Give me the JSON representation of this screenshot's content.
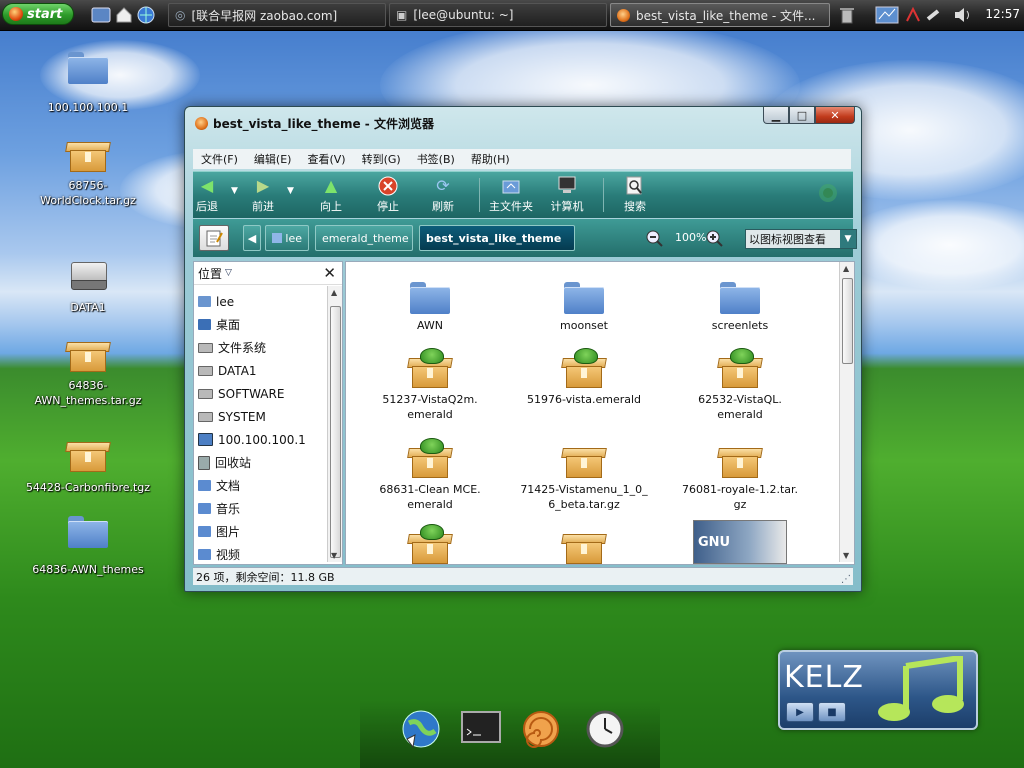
{
  "top_panel": {
    "start_label": "start",
    "tasks": [
      {
        "label": "[联合早报网 zaobao.com]"
      },
      {
        "label": "[lee@ubuntu: ~]"
      },
      {
        "label": "best_vista_like_theme - 文件..."
      }
    ],
    "clock": "12:57"
  },
  "desktop": {
    "icons": [
      {
        "label": "100.100.100.1"
      },
      {
        "label": "68756-WorldClock.tar.gz"
      },
      {
        "label": "DATA1"
      },
      {
        "label": "64836-AWN_themes.tar.gz"
      },
      {
        "label": "54428-Carbonfibre.tgz"
      },
      {
        "label": "64836-AWN_themes"
      }
    ]
  },
  "window": {
    "title": "best_vista_like_theme - 文件浏览器",
    "menu": [
      "文件(F)",
      "编辑(E)",
      "查看(V)",
      "转到(G)",
      "书签(B)",
      "帮助(H)"
    ],
    "toolbar": {
      "back": "后退",
      "forward": "前进",
      "up": "向上",
      "stop": "停止",
      "reload": "刷新",
      "home": "主文件夹",
      "computer": "计算机",
      "search": "搜索"
    },
    "breadcrumbs": [
      "lee",
      "emerald_theme",
      "best_vista_like_theme"
    ],
    "zoom": "100%",
    "view_mode": "以图标视图查看",
    "sidebar": {
      "title": "位置",
      "items": [
        {
          "label": "lee",
          "icon": "home"
        },
        {
          "label": "桌面",
          "icon": "desk"
        },
        {
          "label": "文件系统",
          "icon": "drive"
        },
        {
          "label": "DATA1",
          "icon": "drive"
        },
        {
          "label": "SOFTWARE",
          "icon": "drive"
        },
        {
          "label": "SYSTEM",
          "icon": "drive"
        },
        {
          "label": "100.100.100.1",
          "icon": "net"
        },
        {
          "label": "回收站",
          "icon": "trash"
        },
        {
          "label": "文档",
          "icon": "fold"
        },
        {
          "label": "音乐",
          "icon": "fold"
        },
        {
          "label": "图片",
          "icon": "fold"
        },
        {
          "label": "视频",
          "icon": "fold"
        }
      ]
    },
    "files": [
      {
        "line1": "AWN",
        "line2": "",
        "type": "folder"
      },
      {
        "line1": "moonset",
        "line2": "",
        "type": "folder"
      },
      {
        "line1": "screenlets",
        "line2": "",
        "type": "folder"
      },
      {
        "line1": "51237-VistaQ2m.",
        "line2": "emerald",
        "type": "emerald"
      },
      {
        "line1": "51976-vista.emerald",
        "line2": "",
        "type": "emerald"
      },
      {
        "line1": "62532-VistaQL.",
        "line2": "emerald",
        "type": "emerald"
      },
      {
        "line1": "68631-Clean MCE.",
        "line2": "emerald",
        "type": "emerald"
      },
      {
        "line1": "71425-Vistamenu_1_0_",
        "line2": "6_beta.tar.gz",
        "type": "archive"
      },
      {
        "line1": "76081-royale-1.2.tar.",
        "line2": "gz",
        "type": "archive"
      },
      {
        "line1": "",
        "line2": "",
        "type": "emerald"
      },
      {
        "line1": "",
        "line2": "",
        "type": "archive"
      },
      {
        "line1": "",
        "line2": "",
        "type": "image",
        "thumb_text": "GNU"
      }
    ],
    "status": "26 项，剩余空间：11.8 GB"
  },
  "kelz": {
    "title": "KELZ"
  }
}
